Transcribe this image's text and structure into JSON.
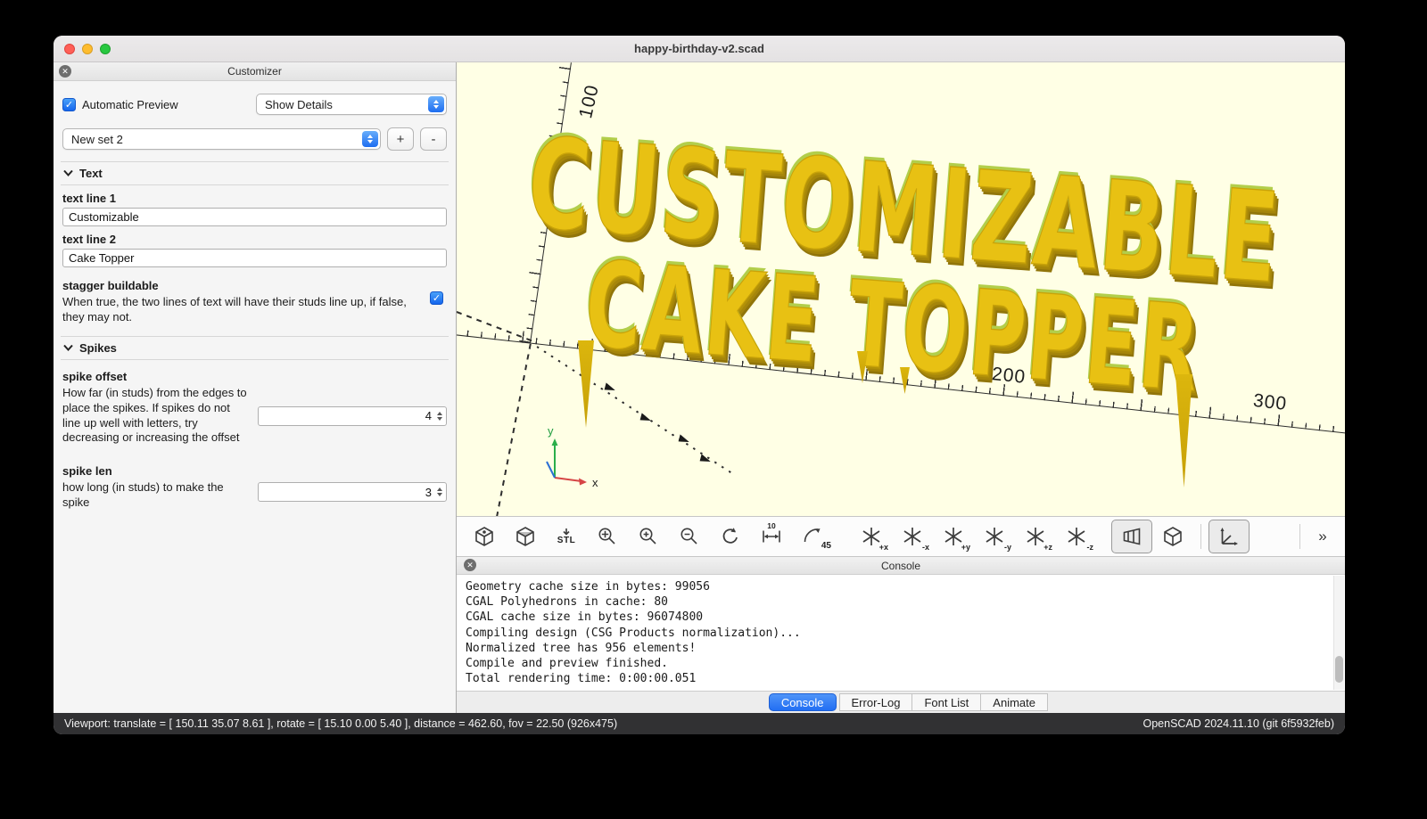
{
  "window": {
    "title": "happy-birthday-v2.scad",
    "statusbar": {
      "left": "Viewport: translate = [ 150.11 35.07 8.61 ], rotate = [ 15.10 0.00 5.40 ], distance = 462.60, fov = 22.50 (926x475)",
      "right": "OpenSCAD 2024.11.10 (git 6f5932feb)"
    }
  },
  "icons": {
    "close": "✕",
    "check": "✓"
  },
  "customizer": {
    "title": "Customizer",
    "auto_preview": "Automatic Preview",
    "details_value": "Show Details",
    "preset_value": "New set 2",
    "add_label": "+",
    "remove_label": "-",
    "text": {
      "title": "Text",
      "line1_label": "text line 1",
      "line1_value": "Customizable",
      "line2_label": "text line 2",
      "line2_value": "Cake Topper",
      "stagger_label": "stagger buildable",
      "stagger_desc": "When true, the two lines of text will have their studs line up, if false, they may not."
    },
    "spikes": {
      "title": "Spikes",
      "offset_label": "spike offset",
      "offset_desc": "How far (in studs) from the edges to place the spikes. If spikes do not line up well with letters, try decreasing or increasing the offset",
      "offset_value": "4",
      "len_label": "spike len",
      "len_desc": "how long (in studs) to make the spike",
      "len_value": "3"
    }
  },
  "viewport": {
    "line1": "CUSTOMIZABLE",
    "line2": "CAKE TOPPER",
    "label_100": "100",
    "label_200": "200",
    "label_300": "300",
    "axis_x": "x",
    "axis_y": "y",
    "background": "#FFFFE5",
    "model_color": "#E8C113"
  },
  "toolbar": {
    "items": [
      {
        "name": "render-preview",
        "label": ""
      },
      {
        "name": "render",
        "label": ""
      },
      {
        "name": "export-stl",
        "label": "STL"
      },
      {
        "name": "zoom-all",
        "label": ""
      },
      {
        "name": "zoom-in",
        "label": ""
      },
      {
        "name": "zoom-out",
        "label": ""
      },
      {
        "name": "reset-view",
        "label": ""
      },
      {
        "name": "view-all",
        "label": "10"
      },
      {
        "name": "rotate-45",
        "label": "45"
      },
      {
        "name": "view-right",
        "label": "+x"
      },
      {
        "name": "view-left",
        "label": "-x"
      },
      {
        "name": "view-back",
        "label": "+y"
      },
      {
        "name": "view-front",
        "label": "-y"
      },
      {
        "name": "view-top",
        "label": "+z"
      },
      {
        "name": "view-bottom",
        "label": "-z"
      },
      {
        "name": "perspective",
        "label": ""
      },
      {
        "name": "orthogonal",
        "label": ""
      },
      {
        "name": "show-axes",
        "label": ""
      },
      {
        "name": "more",
        "label": "»"
      }
    ]
  },
  "console": {
    "title": "Console",
    "lines": [
      "Geometry cache size in bytes: 99056",
      "CGAL Polyhedrons in cache: 80",
      "CGAL cache size in bytes: 96074800",
      "Compiling design (CSG Products normalization)...",
      "Normalized tree has 956 elements!",
      "Compile and preview finished.",
      "Total rendering time: 0:00:00.051"
    ],
    "tabs": [
      {
        "label": "Console"
      },
      {
        "label": "Error-Log"
      },
      {
        "label": "Font List"
      },
      {
        "label": "Animate"
      }
    ]
  }
}
